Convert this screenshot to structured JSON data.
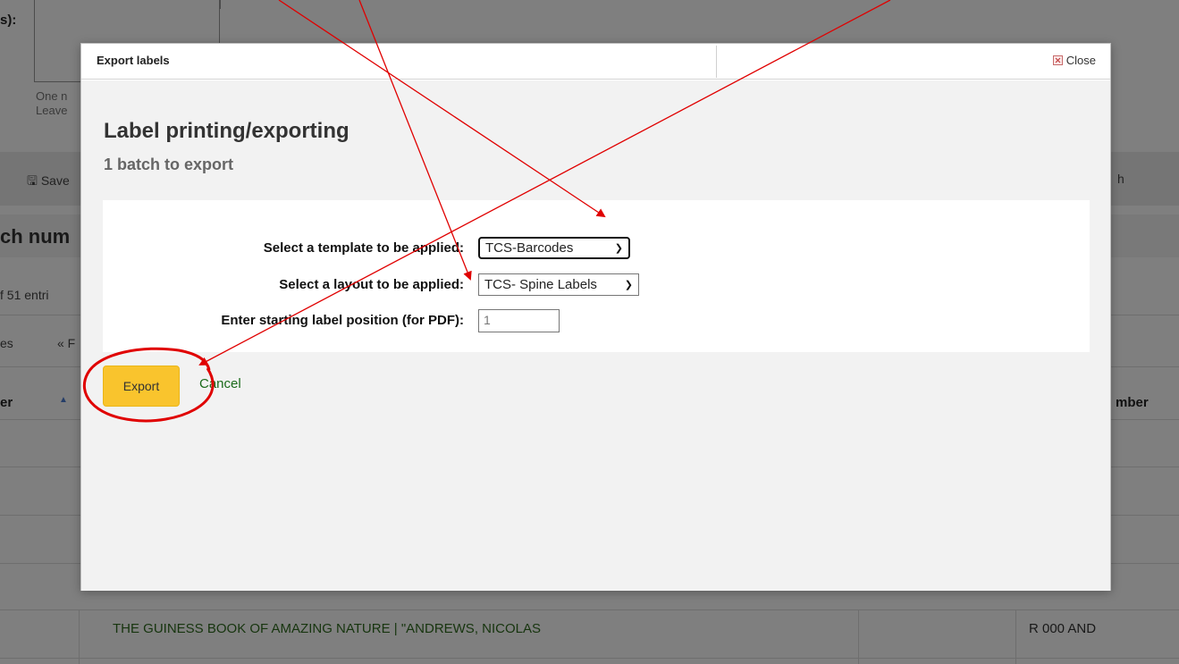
{
  "background": {
    "top_fragment": "s):",
    "hint_line1": "One n",
    "hint_line2": "Leave",
    "toolbar_left": "Save",
    "toolbar_right": "h",
    "heading_fragment": "ch num",
    "entries_fragment": "f 51 entri",
    "pager_left": "es",
    "pager_first": "« F",
    "table_header_left": "er",
    "table_header_right": "mber",
    "row_title": "THE GUINESS BOOK OF AMAZING NATURE | \"ANDREWS, NICOLAS",
    "row_call_number": "R 000 AND"
  },
  "modal": {
    "header_title": "Export labels",
    "close_label": "Close",
    "title": "Label printing/exporting",
    "subtitle": "1 batch to export",
    "form": {
      "template_label": "Select a template to be applied:",
      "template_value": "TCS-Barcodes",
      "layout_label": "Select a layout to be applied:",
      "layout_value": "TCS- Spine Labels",
      "position_label": "Enter starting label position (for PDF):",
      "position_value": "1"
    },
    "export_button": "Export",
    "cancel_link": "Cancel"
  },
  "colors": {
    "export_button_bg": "#f9c42d",
    "cancel_link": "#1a6a1a",
    "annotation_red": "#e00000",
    "overlay": "rgba(0,0,0,0.5)"
  }
}
